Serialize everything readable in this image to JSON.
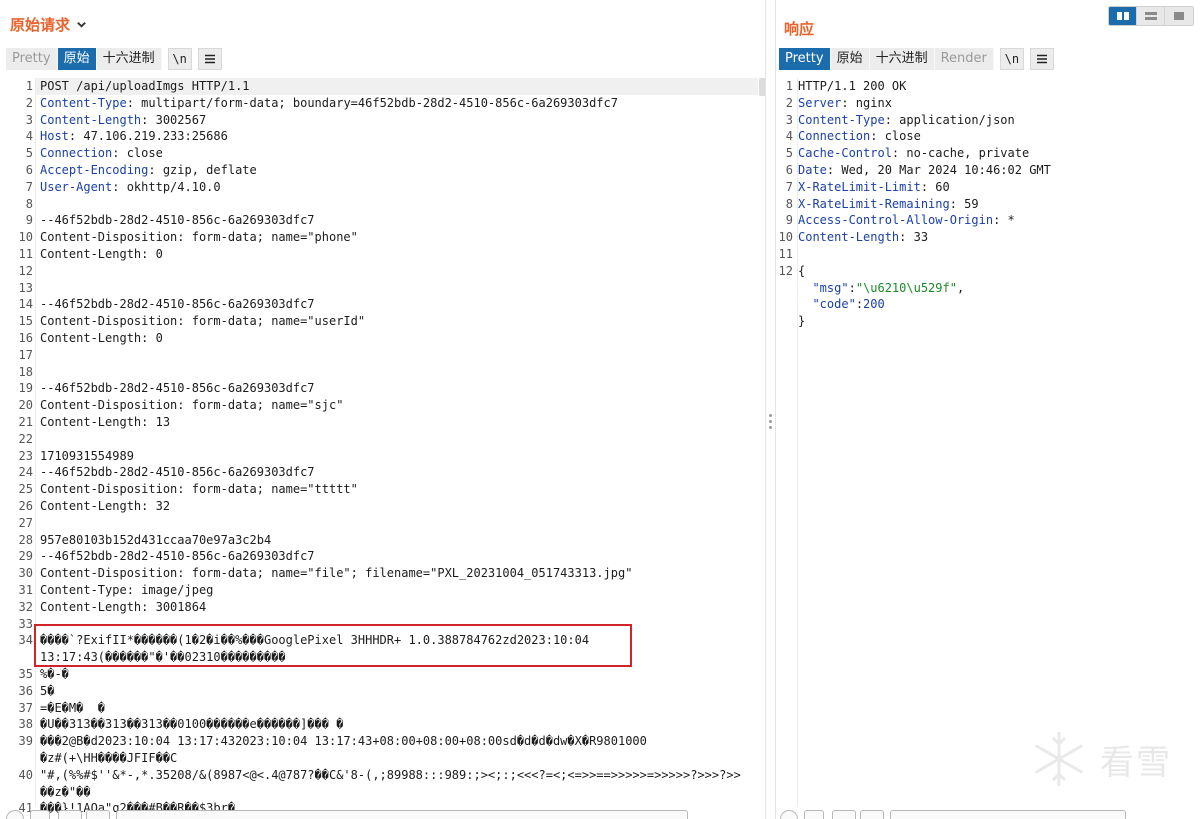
{
  "request": {
    "title": "原始请求",
    "tabs": [
      "Pretty",
      "原始",
      "十六进制"
    ],
    "active_tab": "原始",
    "newline_label": "\\n",
    "menu_label": "≡",
    "lines": [
      {
        "n": "1",
        "h": "",
        "t": "POST /api/uploadImgs HTTP/1.1"
      },
      {
        "n": "2",
        "h": "Content-Type",
        "t": ": multipart/form-data; boundary=46f52bdb-28d2-4510-856c-6a269303dfc7"
      },
      {
        "n": "3",
        "h": "Content-Length",
        "t": ": 3002567"
      },
      {
        "n": "4",
        "h": "Host",
        "t": ": 47.106.219.233:25686"
      },
      {
        "n": "5",
        "h": "Connection",
        "t": ": close"
      },
      {
        "n": "6",
        "h": "Accept-Encoding",
        "t": ": gzip, deflate"
      },
      {
        "n": "7",
        "h": "User-Agent",
        "t": ": okhttp/4.10.0"
      },
      {
        "n": "8",
        "h": "",
        "t": ""
      },
      {
        "n": "9",
        "h": "",
        "t": "--46f52bdb-28d2-4510-856c-6a269303dfc7"
      },
      {
        "n": "10",
        "h": "",
        "t": "Content-Disposition: form-data; name=\"phone\""
      },
      {
        "n": "11",
        "h": "",
        "t": "Content-Length: 0"
      },
      {
        "n": "12",
        "h": "",
        "t": ""
      },
      {
        "n": "13",
        "h": "",
        "t": ""
      },
      {
        "n": "14",
        "h": "",
        "t": "--46f52bdb-28d2-4510-856c-6a269303dfc7"
      },
      {
        "n": "15",
        "h": "",
        "t": "Content-Disposition: form-data; name=\"userId\""
      },
      {
        "n": "16",
        "h": "",
        "t": "Content-Length: 0"
      },
      {
        "n": "17",
        "h": "",
        "t": ""
      },
      {
        "n": "18",
        "h": "",
        "t": ""
      },
      {
        "n": "19",
        "h": "",
        "t": "--46f52bdb-28d2-4510-856c-6a269303dfc7"
      },
      {
        "n": "20",
        "h": "",
        "t": "Content-Disposition: form-data; name=\"sjc\""
      },
      {
        "n": "21",
        "h": "",
        "t": "Content-Length: 13"
      },
      {
        "n": "22",
        "h": "",
        "t": ""
      },
      {
        "n": "23",
        "h": "",
        "t": "1710931554989"
      },
      {
        "n": "24",
        "h": "",
        "t": "--46f52bdb-28d2-4510-856c-6a269303dfc7"
      },
      {
        "n": "25",
        "h": "",
        "t": "Content-Disposition: form-data; name=\"ttttt\""
      },
      {
        "n": "26",
        "h": "",
        "t": "Content-Length: 32"
      },
      {
        "n": "27",
        "h": "",
        "t": ""
      },
      {
        "n": "28",
        "h": "",
        "t": "957e80103b152d431ccaa70e97a3c2b4"
      },
      {
        "n": "29",
        "h": "",
        "t": "--46f52bdb-28d2-4510-856c-6a269303dfc7"
      },
      {
        "n": "30",
        "h": "",
        "t": "Content-Disposition: form-data; name=\"file\"; filename=\"PXL_20231004_051743313.jpg\""
      },
      {
        "n": "31",
        "h": "",
        "t": "Content-Type: image/jpeg"
      },
      {
        "n": "32",
        "h": "",
        "t": "Content-Length: 3001864"
      },
      {
        "n": "33",
        "h": "",
        "t": ""
      },
      {
        "n": "34",
        "h": "",
        "t": "����`?ExifII*������(1�2�i��%���GooglePixel 3HHHDR+ 1.0.388784762zd2023:10:04"
      },
      {
        "n": "",
        "h": "",
        "t": "13:17:43(������\"�'��02310���������"
      },
      {
        "n": "35",
        "h": "",
        "t": "%�-�"
      },
      {
        "n": "36",
        "h": "",
        "t": "5�"
      },
      {
        "n": "37",
        "h": "",
        "t": "=�E�M�  �"
      },
      {
        "n": "38",
        "h": "",
        "t": "�U��313��313��313��0100������e������]��� �"
      },
      {
        "n": "39",
        "h": "",
        "t": "���2@B�d2023:10:04 13:17:432023:10:04 13:17:43+08:00+08:00+08:00sd�d�d�dw�X�R9801000"
      },
      {
        "n": "",
        "h": "",
        "t": "�z#(+\\HH����JFIF��C"
      },
      {
        "n": "40",
        "h": "",
        "t": "\"#,(%%#$''&*-,*.35208/&(8987<@<.4@787?��C&'8-(,;89988:::989:;><;:;<<<?=<;<=>>==>>>>>=>>>>>?>>>?>>"
      },
      {
        "n": "",
        "h": "",
        "t": "��z�\"��"
      },
      {
        "n": "41",
        "h": "",
        "t": "���}!1AQa\"q2���#B��R��$3br�"
      }
    ]
  },
  "response": {
    "title": "响应",
    "tabs": [
      "Pretty",
      "原始",
      "十六进制",
      "Render"
    ],
    "active_tab": "Pretty",
    "newline_label": "\\n",
    "menu_label": "≡",
    "lines": [
      {
        "n": "1",
        "h": "",
        "t": "HTTP/1.1 200 OK"
      },
      {
        "n": "2",
        "h": "Server",
        "t": ": nginx"
      },
      {
        "n": "3",
        "h": "Content-Type",
        "t": ": application/json"
      },
      {
        "n": "4",
        "h": "Connection",
        "t": ": close"
      },
      {
        "n": "5",
        "h": "Cache-Control",
        "t": ": no-cache, private"
      },
      {
        "n": "6",
        "h": "Date",
        "t": ": Wed, 20 Mar 2024 10:46:02 GMT"
      },
      {
        "n": "7",
        "h": "X-RateLimit-Limit",
        "t": ": 60"
      },
      {
        "n": "8",
        "h": "X-RateLimit-Remaining",
        "t": ": 59"
      },
      {
        "n": "9",
        "h": "Access-Control-Allow-Origin",
        "t": ": *"
      },
      {
        "n": "10",
        "h": "Content-Length",
        "t": ": 33"
      },
      {
        "n": "11",
        "h": "",
        "t": ""
      },
      {
        "n": "12",
        "h": "",
        "t": "{"
      },
      {
        "n": "",
        "h": "",
        "t": "",
        "json": [
          {
            "key": "\"msg\"",
            "sep": ":",
            "val": "\"\\u6210\\u529f\"",
            "tail": ",",
            "valtype": "s"
          }
        ]
      },
      {
        "n": "",
        "h": "",
        "t": "",
        "json": [
          {
            "key": "\"code\"",
            "sep": ":",
            "val": "200",
            "tail": "",
            "valtype": "n"
          }
        ]
      },
      {
        "n": "",
        "h": "",
        "t": "}"
      }
    ]
  },
  "watermark": {
    "text": "看雪"
  },
  "colors": {
    "accent": "#e8642c",
    "active_tab": "#1b6cad",
    "header_key": "#1b3fa8",
    "json_string": "#1a8a2a",
    "highlight_box": "#d2222a"
  }
}
